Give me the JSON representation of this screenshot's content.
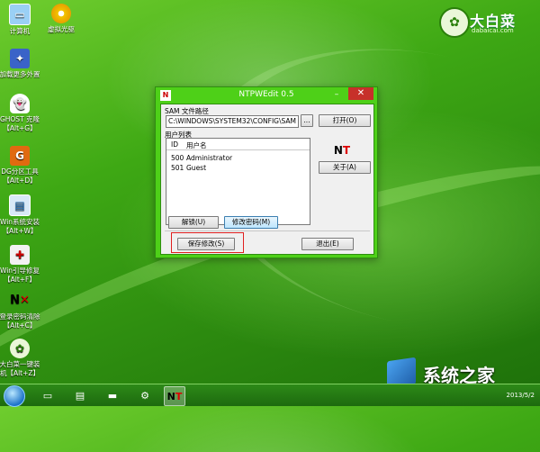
{
  "desktop": {
    "icons": [
      {
        "label": "计算机",
        "icon": "computer-icon"
      },
      {
        "label": "虚拟光驱",
        "icon": "disc-icon"
      },
      {
        "label": "加载更多外置",
        "icon": "plugin-icon"
      },
      {
        "label": "GHOST 克隆",
        "label2": "【Alt+G】",
        "icon": "ghost-icon"
      },
      {
        "label": "DG分区工具",
        "label2": "【Alt+D】",
        "icon": "partition-icon"
      },
      {
        "label": "Win系统安装",
        "label2": "【Alt+W】",
        "icon": "installer-icon"
      },
      {
        "label": "Win引导修复",
        "label2": "【Alt+F】",
        "icon": "boot-repair-icon"
      },
      {
        "label": "登录密码清除",
        "label2": "【Alt+C】",
        "icon": "ntpw-icon"
      },
      {
        "label": "大白菜一键装",
        "label2": "机【Alt+Z】",
        "icon": "cabbage-icon"
      }
    ]
  },
  "logo": {
    "name": "大白菜",
    "url": "dabaicai.com"
  },
  "window": {
    "title": "NTPWEdit 0.5",
    "sam_label": "SAM 文件路径",
    "sam_path": "C:\\WINDOWS\\SYSTEM32\\CONFIG\\SAM",
    "browse_label": "...",
    "open_label": "打开(O)",
    "user_list_label": "用户列表",
    "columns": [
      "ID",
      "用户名"
    ],
    "users": [
      {
        "id": "500",
        "name": "Administrator"
      },
      {
        "id": "501",
        "name": "Guest"
      }
    ],
    "about_label": "关于(A)",
    "unlock_label": "解锁(U)",
    "change_password_label": "修改密码(M)",
    "save_label": "保存修改(S)",
    "exit_label": "退出(E)"
  },
  "watermark": {
    "text": "系统之家"
  },
  "taskbar": {
    "tray_text": "2013/5/2"
  }
}
